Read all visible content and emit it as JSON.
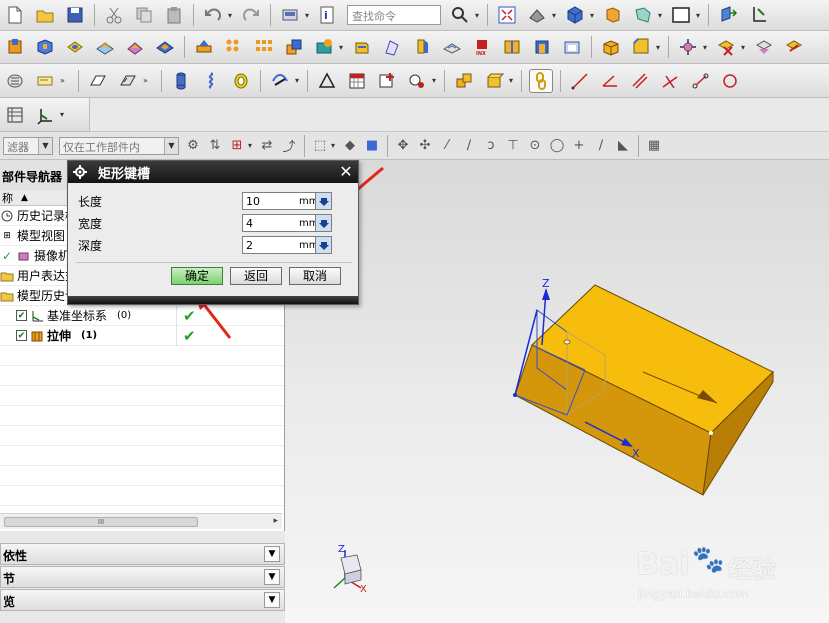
{
  "toolbar": {
    "search_placeholder": "查找命令"
  },
  "filterbar": {
    "filter_combo": "滤器",
    "scope_combo": "仅在工作部件内"
  },
  "navigator": {
    "title": "部件导航器",
    "col_header": "称",
    "rows": [
      {
        "label": "历史记录模"
      },
      {
        "label": "模型视图"
      },
      {
        "label": "摄像机"
      },
      {
        "label": "用户表达式"
      },
      {
        "label": "模型历史记"
      },
      {
        "label": "基准坐标系",
        "suffix": "(0)",
        "status": "✔"
      },
      {
        "label": "拉伸",
        "suffix": "(1)",
        "status": "✔"
      }
    ],
    "scroll_thumb": "III"
  },
  "panels": {
    "p1": "依性",
    "p2": "节",
    "p3": "览"
  },
  "dialog": {
    "title": "矩形键槽",
    "fields": [
      {
        "label": "长度",
        "value": "10",
        "unit": "mm"
      },
      {
        "label": "宽度",
        "value": "4",
        "unit": "mm"
      },
      {
        "label": "深度",
        "value": "2",
        "unit": "mm"
      }
    ],
    "buttons": {
      "ok": "确定",
      "back": "返回",
      "cancel": "取消"
    }
  },
  "viewport": {
    "axis_z": "Z",
    "axis_x": "X",
    "triad_z": "Z",
    "triad_x": "X"
  },
  "watermark": {
    "brand": "Bai",
    "brand2": "经验",
    "url": "jingyan.baidu.com"
  },
  "colors": {
    "block_top": "#f5be0b",
    "block_side": "#d79a06",
    "axis_blue": "#1a2bd8",
    "annotation_red": "#e8231a"
  }
}
